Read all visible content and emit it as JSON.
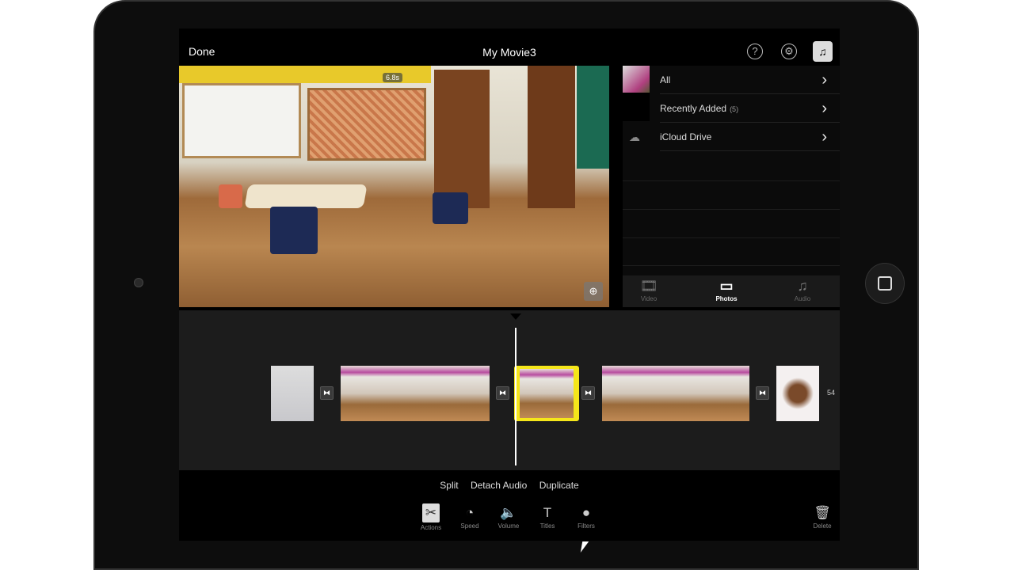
{
  "header": {
    "done": "Done",
    "title": "My Movie3",
    "help_icon": "question-circle-icon",
    "settings_icon": "gear-icon",
    "media_icon": "media-library-icon"
  },
  "viewer": {
    "clip_duration": "6.8s",
    "zoom_icon": "magnifier-plus-icon"
  },
  "browser": {
    "items": [
      {
        "label": "All"
      },
      {
        "label": "Recently Added",
        "count": "(5)"
      },
      {
        "label": "iCloud Drive"
      }
    ],
    "tabs": [
      {
        "label": "Video",
        "icon": "film-icon"
      },
      {
        "label": "Photos",
        "icon": "photos-icon",
        "active": true
      },
      {
        "label": "Audio",
        "icon": "music-note-icon"
      }
    ]
  },
  "timeline": {
    "end_label": "54",
    "selection_color": "#f5e61a"
  },
  "actions": {
    "split": "Split",
    "detach_audio": "Detach Audio",
    "duplicate": "Duplicate"
  },
  "toolbar": {
    "tools": [
      {
        "label": "Actions",
        "icon": "scissors-icon",
        "active": true
      },
      {
        "label": "Speed",
        "icon": "speedometer-icon"
      },
      {
        "label": "Volume",
        "icon": "speaker-icon"
      },
      {
        "label": "Titles",
        "icon": "text-icon"
      },
      {
        "label": "Filters",
        "icon": "filters-icon"
      }
    ],
    "delete": "Delete"
  }
}
